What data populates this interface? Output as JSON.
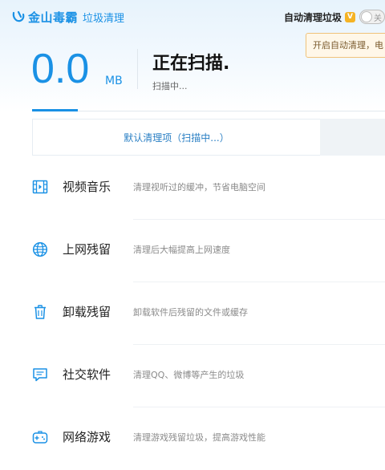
{
  "brand": {
    "name": "金山毒霸",
    "subtitle": "垃圾清理"
  },
  "auto_clean": {
    "label": "自动清理垃圾",
    "vip_badge": "V",
    "toggle_text": "关",
    "tooltip": "开启自动清理，电"
  },
  "scan": {
    "size_value": "0.0",
    "size_unit": "MB",
    "title": "正在扫描.",
    "subtitle": "扫描中...",
    "progress_fraction": 0.13
  },
  "tabs": {
    "active_label": "默认清理项（扫描中...）"
  },
  "items": [
    {
      "title": "视频音乐",
      "desc": "清理视听过的缓冲，节省电脑空间",
      "icon": "video-icon"
    },
    {
      "title": "上网残留",
      "desc": "清理后大幅提高上网速度",
      "icon": "globe-icon"
    },
    {
      "title": "卸载残留",
      "desc": "卸载软件后残留的文件或缓存",
      "icon": "trash-icon"
    },
    {
      "title": "社交软件",
      "desc": "清理QQ、微博等产生的垃圾",
      "icon": "chat-icon"
    },
    {
      "title": "网络游戏",
      "desc": "清理游戏残留垃圾，提高游戏性能",
      "icon": "gamepad-icon"
    }
  ],
  "colors": {
    "accent": "#1a91e5",
    "tooltip_bg": "#fff7e8",
    "vip": "#f5b324"
  }
}
